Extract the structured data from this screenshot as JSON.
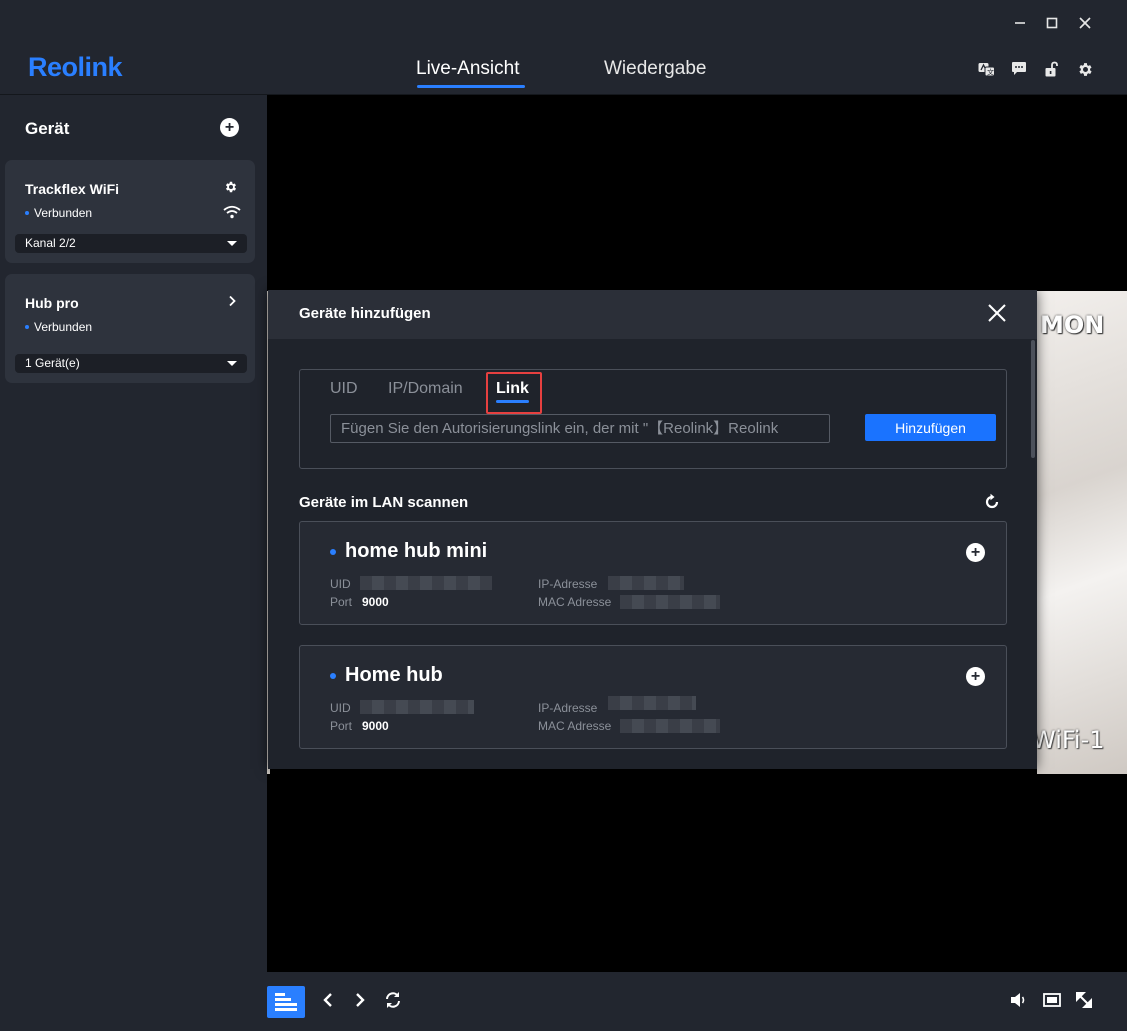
{
  "window": {
    "minimize_icon": "minimize-icon",
    "maximize_icon": "maximize-icon",
    "close_icon": "close-icon"
  },
  "header": {
    "logo": "Reolink",
    "tabs": [
      {
        "label": "Live-Ansicht",
        "active": true
      },
      {
        "label": "Wiedergabe",
        "active": false
      }
    ],
    "icons": [
      "translate-icon",
      "chat-icon",
      "unlock-icon",
      "gear-icon"
    ],
    "accent_color": "#2a7fff"
  },
  "sidebar": {
    "title": "Gerät",
    "devices": [
      {
        "name": "Trackflex WiFi",
        "status": "Verbunden",
        "select": "Kanal 2/2"
      },
      {
        "name": "Hub pro",
        "status": "Verbunden",
        "select": "1 Gerät(e)"
      }
    ]
  },
  "video": {
    "overlay_top": "MON",
    "overlay_bottom": "WiFi-1"
  },
  "modal": {
    "title": "Geräte hinzufügen",
    "tabs": [
      {
        "label": "UID",
        "active": false
      },
      {
        "label": "IP/Domain",
        "active": false
      },
      {
        "label": "Link",
        "active": true
      }
    ],
    "link_placeholder": "Fügen Sie den Autorisierungslink ein, der mit \"【Reolink】Reolink",
    "add_button": "Hinzufügen",
    "lan_title": "Geräte im LAN scannen",
    "devices": [
      {
        "name": "home hub mini",
        "uid_label": "UID",
        "port_label": "Port",
        "port": "9000",
        "ip_label": "IP-Adresse",
        "mac_label": "MAC Adresse"
      },
      {
        "name": "Home hub",
        "uid_label": "UID",
        "port_label": "Port",
        "port": "9000",
        "ip_label": "IP-Adresse",
        "mac_label": "MAC Adresse"
      }
    ]
  },
  "bottombar": {
    "icons": [
      "layout-icon",
      "chevron-left-icon",
      "chevron-right-icon",
      "sync-icon",
      "volume-icon",
      "aspect-ratio-icon",
      "fullscreen-icon"
    ]
  }
}
